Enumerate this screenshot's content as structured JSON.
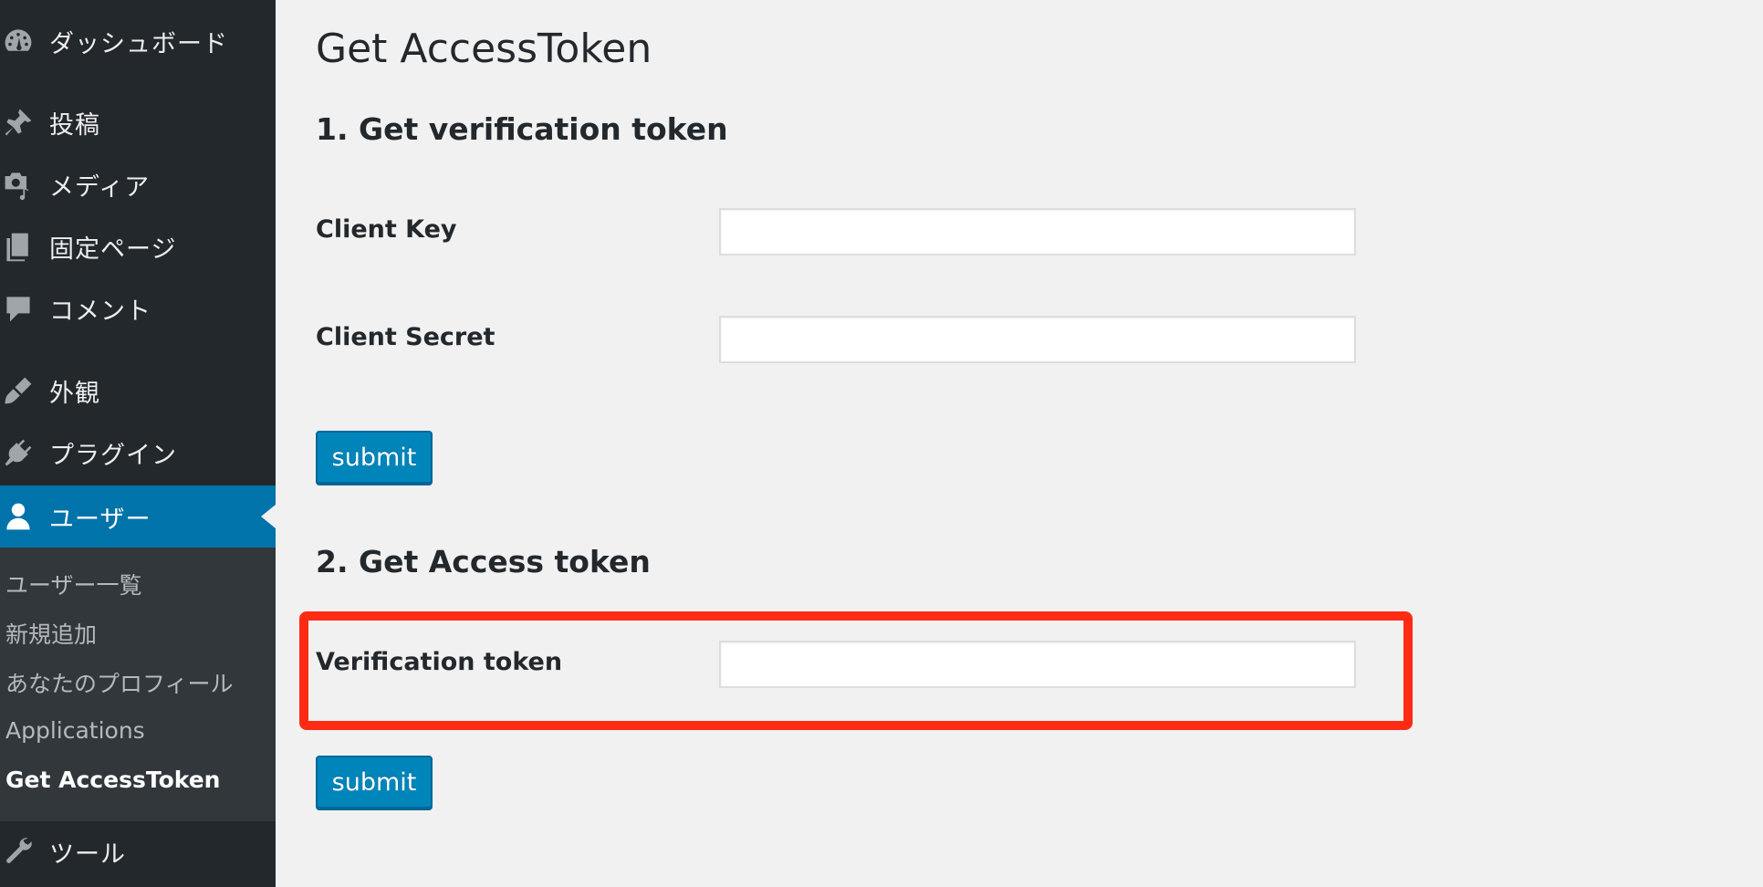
{
  "sidebar": {
    "items": [
      {
        "label": "ダッシュボード",
        "icon": "dashboard-icon"
      },
      {
        "label": "投稿",
        "icon": "pin-icon"
      },
      {
        "label": "メディア",
        "icon": "media-icon"
      },
      {
        "label": "固定ページ",
        "icon": "pages-icon"
      },
      {
        "label": "コメント",
        "icon": "comment-icon"
      },
      {
        "label": "外観",
        "icon": "brush-icon"
      },
      {
        "label": "プラグイン",
        "icon": "plugin-icon"
      },
      {
        "label": "ユーザー",
        "icon": "user-icon"
      },
      {
        "label": "ツール",
        "icon": "wrench-icon"
      }
    ],
    "submenu": [
      {
        "label": "ユーザー一覧"
      },
      {
        "label": "新規追加"
      },
      {
        "label": "あなたのプロフィール"
      },
      {
        "label": "Applications"
      },
      {
        "label": "Get AccessToken"
      }
    ]
  },
  "main": {
    "title": "Get AccessToken",
    "section1": {
      "title": "1. Get verification token",
      "client_key_label": "Client Key",
      "client_key_value": "",
      "client_secret_label": "Client Secret",
      "client_secret_value": "",
      "submit_label": "submit"
    },
    "section2": {
      "title": "2. Get Access token",
      "verification_label": "Verification token",
      "verification_value": "",
      "submit_label": "submit"
    }
  },
  "colors": {
    "sidebar_bg": "#23282d",
    "submenu_bg": "#32373c",
    "active_bg": "#0073aa",
    "button_bg": "#0085ba",
    "highlight": "#ff2b14"
  }
}
